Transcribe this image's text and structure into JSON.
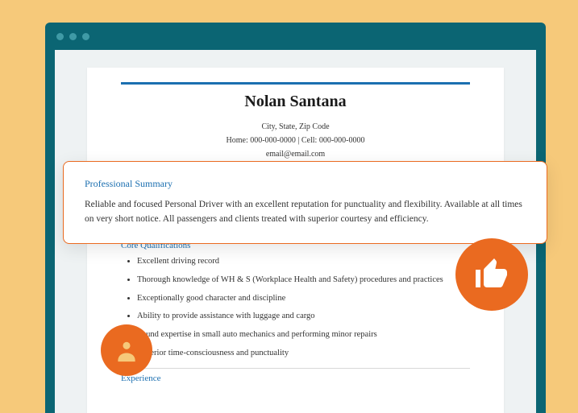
{
  "resume": {
    "name": "Nolan Santana",
    "contact": {
      "address": "City, State, Zip Code",
      "phones": "Home: 000-000-0000 | Cell: 000-000-0000",
      "email": "email@email.com"
    },
    "summary": {
      "title": "Professional Summary",
      "body": "Reliable and focused Personal Driver with an excellent reputation for punctuality and flexibility. Available at all times on very short notice. All passengers and clients treated with superior courtesy and efficiency."
    },
    "qualifications": {
      "title": "Core Qualifications",
      "items": [
        "Excellent driving record",
        "Thorough knowledge of WH & S (Workplace Health and Safety) procedures and practices",
        "Exceptionally good character and discipline",
        "Ability to provide assistance with luggage and cargo",
        "Sound expertise in small auto mechanics and performing minor repairs",
        "Superior time-consciousness and punctuality"
      ]
    },
    "experience": {
      "title": "Experience"
    }
  },
  "icons": {
    "person": "person-icon",
    "thumbs_up": "thumbs-up-icon"
  }
}
